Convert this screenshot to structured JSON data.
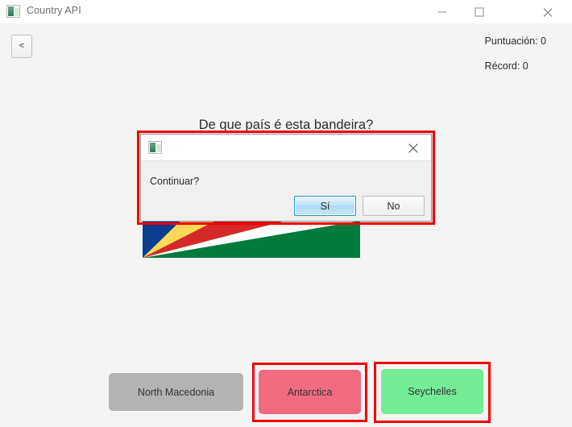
{
  "window": {
    "title": "Country API",
    "app_icon": "image-icon",
    "controls": {
      "minimize": "minimize-icon",
      "maximize": "maximize-icon",
      "close": "close-icon"
    }
  },
  "toolbar": {
    "back_label": "<"
  },
  "score": {
    "points_label": "Puntuación: 0",
    "record_label": "Récord: 0"
  },
  "quiz": {
    "question": "De que país é esta bandeira?",
    "flag": {
      "name": "seychelles-flag",
      "colors": {
        "blue": "#0b3d91",
        "yellow": "#fcd856",
        "red": "#d62828",
        "white": "#ffffff",
        "green": "#007a3d"
      }
    },
    "answers": [
      {
        "label": "North Macedonia",
        "color": "#b3b3b3",
        "state": "neutral"
      },
      {
        "label": "Antarctica",
        "color": "#f06b80",
        "state": "incorrect"
      },
      {
        "label": "Seychelles",
        "color": "#74eb95",
        "state": "correct"
      }
    ]
  },
  "dialog": {
    "title": "",
    "icon": "image-icon",
    "close_icon": "close-icon",
    "message": "Continuar?",
    "buttons": {
      "yes": "Sí",
      "no": "No"
    }
  },
  "annotations": {
    "color": "#f40000",
    "boxes": [
      "dialog",
      "answer-antarctica",
      "answer-seychelles"
    ]
  }
}
